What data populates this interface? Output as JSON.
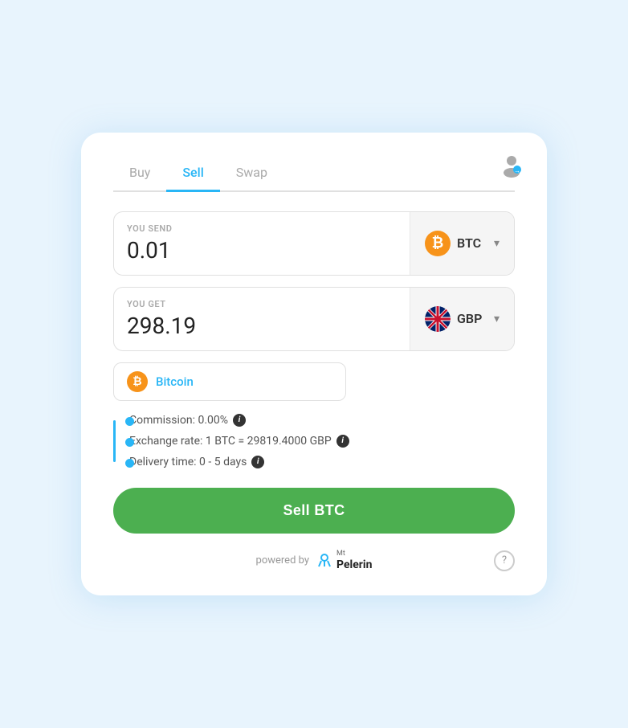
{
  "tabs": [
    {
      "id": "buy",
      "label": "Buy",
      "active": false
    },
    {
      "id": "sell",
      "label": "Sell",
      "active": true
    },
    {
      "id": "swap",
      "label": "Swap",
      "active": false
    }
  ],
  "send_section": {
    "label": "YOU SEND",
    "value": "0.01",
    "currency_code": "BTC",
    "currency_icon_type": "btc"
  },
  "get_section": {
    "label": "YOU GET",
    "value": "298.19",
    "currency_code": "GBP",
    "currency_icon_type": "gbp"
  },
  "suggestion": {
    "text": "Bitcoin"
  },
  "info_rows": [
    {
      "text": "Commission: 0.00%",
      "has_info": true
    },
    {
      "text": "Exchange rate: 1 BTC = 29819.4000 GBP",
      "has_info": true
    },
    {
      "text": "Delivery time: 0 - 5 days",
      "has_info": true
    }
  ],
  "sell_button": {
    "label": "Sell BTC"
  },
  "footer": {
    "powered_by": "powered by",
    "brand_mt": "Mt",
    "brand_name": "Pelerin"
  },
  "icons": {
    "btc_symbol": "₿",
    "chevron": "▾",
    "info": "i",
    "question": "?",
    "user": "👤"
  },
  "colors": {
    "active_tab": "#29b6f6",
    "sell_button": "#4caf50",
    "btc_orange": "#f7931a",
    "blue_timeline": "#29b6f6"
  }
}
